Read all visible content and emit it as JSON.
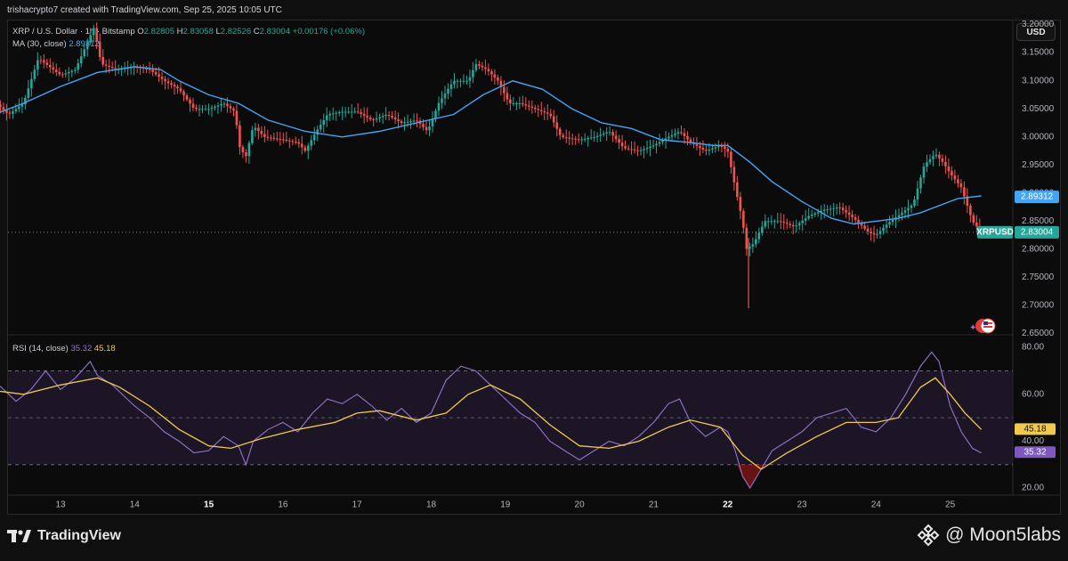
{
  "header": {
    "credit": "trishacrypto7 created with TradingView.com, Sep 25, 2025 10:05 UTC"
  },
  "legend": {
    "symbol": "XRP / U.S. Dollar · 1h · Bitstamp",
    "o_label": "O",
    "o": "2.82805",
    "h_label": "H",
    "h": "2.83058",
    "l_label": "L",
    "l": "2.82526",
    "c_label": "C",
    "c": "2.83004",
    "change": "+0.00176 (+0.06%)",
    "ma_label": "MA (30, close)",
    "ma_value": "2.89312",
    "rsi_label": "RSI (14, close)",
    "rsi_value": "35.32",
    "rsi_ma_value": "45.18"
  },
  "toolbar": {
    "currency_label": "USD"
  },
  "price_tags": {
    "ma": "2.89312",
    "symbol": "XRPUSD",
    "last": "2.83004",
    "rsi_ma": "45.18",
    "rsi": "35.32"
  },
  "colors": {
    "up": "#26a69a",
    "down": "#ef5350",
    "ma": "#42a5f5",
    "rsi": "#9575cd",
    "rsi_ma": "#f2c94c",
    "background": "#0b0b0b"
  },
  "footer": {
    "brand": "TradingView",
    "watermark": "@ Moon5labs"
  },
  "chart_data": [
    {
      "type": "candlestick",
      "title": "XRP / U.S. Dollar · 1h · Bitstamp",
      "x_ticks": [
        "13",
        "14",
        "15",
        "16",
        "17",
        "18",
        "19",
        "20",
        "21",
        "22",
        "23",
        "24",
        "25"
      ],
      "bold_ticks": [
        "15",
        "22"
      ],
      "y_ticks": [
        "3.20000",
        "3.15000",
        "3.10000",
        "3.05000",
        "3.00000",
        "2.95000",
        "2.90000",
        "2.85000",
        "2.80000",
        "2.75000",
        "2.70000",
        "2.65000"
      ],
      "ylim": [
        2.6475,
        3.2075
      ],
      "grid": false,
      "series": [
        {
          "name": "XRPUSD",
          "path": [
            [
              12.0,
              3.075
            ],
            [
              12.3,
              3.04
            ],
            [
              12.5,
              3.06
            ],
            [
              12.7,
              3.14
            ],
            [
              12.9,
              3.12
            ],
            [
              13.0,
              3.11
            ],
            [
              13.2,
              3.12
            ],
            [
              13.35,
              3.165
            ],
            [
              13.45,
              3.195
            ],
            [
              13.55,
              3.13
            ],
            [
              13.75,
              3.12
            ],
            [
              14.0,
              3.125
            ],
            [
              14.2,
              3.12
            ],
            [
              14.4,
              3.1
            ],
            [
              14.6,
              3.085
            ],
            [
              14.8,
              3.05
            ],
            [
              15.0,
              3.05
            ],
            [
              15.2,
              3.06
            ],
            [
              15.35,
              3.045
            ],
            [
              15.42,
              2.98
            ],
            [
              15.5,
              2.965
            ],
            [
              15.6,
              3.02
            ],
            [
              15.75,
              3.0
            ],
            [
              16.0,
              2.995
            ],
            [
              16.2,
              2.99
            ],
            [
              16.3,
              2.975
            ],
            [
              16.45,
              3.01
            ],
            [
              16.6,
              3.04
            ],
            [
              16.8,
              3.045
            ],
            [
              17.0,
              3.045
            ],
            [
              17.2,
              3.03
            ],
            [
              17.4,
              3.04
            ],
            [
              17.6,
              3.025
            ],
            [
              17.8,
              3.03
            ],
            [
              17.95,
              3.01
            ],
            [
              18.1,
              3.06
            ],
            [
              18.3,
              3.1
            ],
            [
              18.5,
              3.1
            ],
            [
              18.6,
              3.13
            ],
            [
              18.75,
              3.12
            ],
            [
              18.9,
              3.1
            ],
            [
              19.05,
              3.06
            ],
            [
              19.2,
              3.06
            ],
            [
              19.4,
              3.05
            ],
            [
              19.6,
              3.04
            ],
            [
              19.75,
              3.0
            ],
            [
              20.0,
              2.995
            ],
            [
              20.2,
              3.0
            ],
            [
              20.4,
              3.01
            ],
            [
              20.6,
              2.98
            ],
            [
              20.8,
              2.975
            ],
            [
              21.0,
              2.985
            ],
            [
              21.2,
              3.0
            ],
            [
              21.35,
              3.01
            ],
            [
              21.5,
              2.99
            ],
            [
              21.7,
              2.975
            ],
            [
              21.9,
              2.985
            ],
            [
              22.0,
              2.975
            ],
            [
              22.1,
              2.91
            ],
            [
              22.2,
              2.85
            ],
            [
              22.25,
              2.8
            ],
            [
              22.35,
              2.81
            ],
            [
              22.5,
              2.85
            ],
            [
              22.7,
              2.85
            ],
            [
              22.9,
              2.84
            ],
            [
              23.1,
              2.86
            ],
            [
              23.3,
              2.87
            ],
            [
              23.5,
              2.875
            ],
            [
              23.7,
              2.855
            ],
            [
              23.9,
              2.83
            ],
            [
              24.0,
              2.825
            ],
            [
              24.15,
              2.845
            ],
            [
              24.3,
              2.86
            ],
            [
              24.5,
              2.88
            ],
            [
              24.65,
              2.95
            ],
            [
              24.8,
              2.97
            ],
            [
              24.9,
              2.955
            ],
            [
              25.0,
              2.935
            ],
            [
              25.15,
              2.91
            ],
            [
              25.3,
              2.85
            ],
            [
              25.42,
              2.83
            ]
          ]
        },
        {
          "name": "MA (30, close)",
          "path": [
            [
              12.0,
              3.035
            ],
            [
              12.5,
              3.06
            ],
            [
              13.0,
              3.09
            ],
            [
              13.5,
              3.115
            ],
            [
              14.0,
              3.125
            ],
            [
              14.35,
              3.12
            ],
            [
              14.6,
              3.1
            ],
            [
              15.0,
              3.075
            ],
            [
              15.4,
              3.06
            ],
            [
              15.8,
              3.03
            ],
            [
              16.3,
              3.01
            ],
            [
              16.8,
              3.0
            ],
            [
              17.3,
              3.01
            ],
            [
              17.8,
              3.025
            ],
            [
              18.3,
              3.04
            ],
            [
              18.7,
              3.075
            ],
            [
              19.1,
              3.1
            ],
            [
              19.5,
              3.085
            ],
            [
              19.9,
              3.05
            ],
            [
              20.3,
              3.025
            ],
            [
              20.7,
              3.015
            ],
            [
              21.1,
              2.995
            ],
            [
              21.5,
              2.99
            ],
            [
              21.8,
              2.985
            ],
            [
              22.0,
              2.985
            ],
            [
              22.3,
              2.955
            ],
            [
              22.6,
              2.92
            ],
            [
              23.0,
              2.885
            ],
            [
              23.4,
              2.855
            ],
            [
              23.7,
              2.845
            ],
            [
              24.0,
              2.85
            ],
            [
              24.3,
              2.855
            ],
            [
              24.6,
              2.865
            ],
            [
              24.9,
              2.88
            ],
            [
              25.1,
              2.89
            ],
            [
              25.42,
              2.895
            ]
          ]
        }
      ],
      "last_price": 2.83004,
      "ma_last": 2.89312
    },
    {
      "type": "line",
      "title": "RSI (14, close)",
      "y_ticks": [
        "80.00",
        "60.00",
        "40.00",
        "20.00"
      ],
      "ylim": [
        17,
        85
      ],
      "bands": [
        70,
        50,
        30
      ],
      "series": [
        {
          "name": "RSI (14, close)",
          "path": [
            [
              12.0,
              68
            ],
            [
              12.2,
              63
            ],
            [
              12.4,
              57
            ],
            [
              12.6,
              62
            ],
            [
              12.8,
              70
            ],
            [
              13.0,
              62
            ],
            [
              13.2,
              67
            ],
            [
              13.4,
              74
            ],
            [
              13.5,
              68
            ],
            [
              13.7,
              64
            ],
            [
              14.0,
              55
            ],
            [
              14.2,
              50
            ],
            [
              14.4,
              44
            ],
            [
              14.6,
              40
            ],
            [
              14.8,
              35
            ],
            [
              15.0,
              36
            ],
            [
              15.2,
              42
            ],
            [
              15.4,
              38
            ],
            [
              15.5,
              30
            ],
            [
              15.6,
              40
            ],
            [
              15.8,
              45
            ],
            [
              16.0,
              48
            ],
            [
              16.2,
              44
            ],
            [
              16.4,
              52
            ],
            [
              16.6,
              58
            ],
            [
              16.8,
              56
            ],
            [
              17.0,
              60
            ],
            [
              17.2,
              55
            ],
            [
              17.4,
              49
            ],
            [
              17.6,
              54
            ],
            [
              17.8,
              48
            ],
            [
              18.0,
              52
            ],
            [
              18.2,
              66
            ],
            [
              18.4,
              72
            ],
            [
              18.6,
              70
            ],
            [
              18.8,
              64
            ],
            [
              19.0,
              58
            ],
            [
              19.2,
              52
            ],
            [
              19.4,
              48
            ],
            [
              19.6,
              40
            ],
            [
              19.8,
              36
            ],
            [
              20.0,
              32
            ],
            [
              20.2,
              36
            ],
            [
              20.4,
              40
            ],
            [
              20.6,
              38
            ],
            [
              20.8,
              42
            ],
            [
              21.0,
              48
            ],
            [
              21.2,
              56
            ],
            [
              21.35,
              58
            ],
            [
              21.5,
              48
            ],
            [
              21.7,
              42
            ],
            [
              21.9,
              46
            ],
            [
              22.0,
              44
            ],
            [
              22.1,
              36
            ],
            [
              22.2,
              25
            ],
            [
              22.3,
              20
            ],
            [
              22.45,
              28
            ],
            [
              22.6,
              36
            ],
            [
              22.8,
              40
            ],
            [
              23.0,
              44
            ],
            [
              23.2,
              50
            ],
            [
              23.4,
              52
            ],
            [
              23.6,
              54
            ],
            [
              23.8,
              46
            ],
            [
              24.0,
              44
            ],
            [
              24.2,
              50
            ],
            [
              24.4,
              60
            ],
            [
              24.6,
              72
            ],
            [
              24.75,
              78
            ],
            [
              24.85,
              74
            ],
            [
              25.0,
              55
            ],
            [
              25.15,
              44
            ],
            [
              25.3,
              37
            ],
            [
              25.42,
              35
            ]
          ]
        },
        {
          "name": "RSI MA",
          "path": [
            [
              12.0,
              62
            ],
            [
              12.5,
              60
            ],
            [
              13.0,
              64
            ],
            [
              13.5,
              67
            ],
            [
              13.8,
              63
            ],
            [
              14.2,
              55
            ],
            [
              14.6,
              45
            ],
            [
              15.0,
              38
            ],
            [
              15.3,
              37
            ],
            [
              15.7,
              41
            ],
            [
              16.2,
              45
            ],
            [
              16.7,
              48
            ],
            [
              17.0,
              52
            ],
            [
              17.3,
              53
            ],
            [
              17.8,
              49
            ],
            [
              18.2,
              52
            ],
            [
              18.5,
              60
            ],
            [
              18.8,
              64
            ],
            [
              19.2,
              58
            ],
            [
              19.6,
              47
            ],
            [
              20.0,
              38
            ],
            [
              20.4,
              37
            ],
            [
              20.8,
              40
            ],
            [
              21.2,
              46
            ],
            [
              21.5,
              49
            ],
            [
              21.9,
              46
            ],
            [
              22.2,
              34
            ],
            [
              22.45,
              28
            ],
            [
              22.8,
              35
            ],
            [
              23.2,
              42
            ],
            [
              23.6,
              48
            ],
            [
              24.0,
              48
            ],
            [
              24.3,
              50
            ],
            [
              24.6,
              63
            ],
            [
              24.8,
              67
            ],
            [
              25.0,
              60
            ],
            [
              25.2,
              52
            ],
            [
              25.42,
              45
            ]
          ]
        }
      ],
      "rsi_last": 35.32,
      "rsi_ma_last": 45.18
    }
  ]
}
